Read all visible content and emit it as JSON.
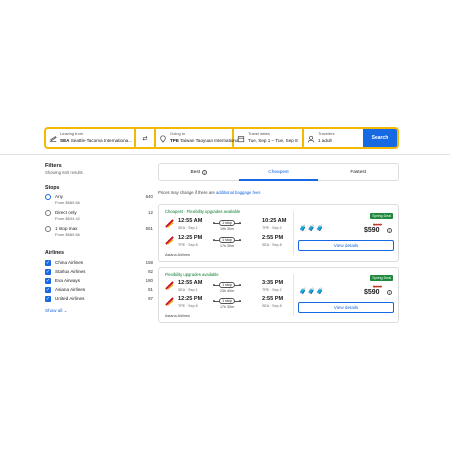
{
  "search": {
    "leaving_label": "Leaving from",
    "leaving_code": "SEA",
    "leaving_name": "Seattle-Tacoma Internationa...",
    "going_label": "Going to",
    "going_code": "TPE",
    "going_name": "Taiwan Taoyuan Internationa...",
    "dates_label": "Travel dates",
    "dates_value": "Tue, Sep 1 – Tue, Sep 8",
    "travelers_label": "Travelers",
    "travelers_value": "1 adult",
    "search_button": "Search",
    "accent_color": "#f5b800",
    "button_color": "#1668e3"
  },
  "sidebar": {
    "title": "Filters",
    "subtitle": "Showing 640 results",
    "stops_heading": "Stops",
    "stops": [
      {
        "label": "Any",
        "price": "From $589.66",
        "count": "640",
        "selected": true
      },
      {
        "label": "Direct only",
        "price": "From $634.42",
        "count": "12",
        "selected": false
      },
      {
        "label": "1 stop max",
        "price": "From $589.66",
        "count": "551",
        "selected": false
      }
    ],
    "airlines_heading": "Airlines",
    "airlines": [
      {
        "label": "China Airlines",
        "count": "158"
      },
      {
        "label": "Starlux Airlines",
        "count": "82"
      },
      {
        "label": "Eva Airways",
        "count": "180"
      },
      {
        "label": "Asiana Airlines",
        "count": "81"
      },
      {
        "label": "United Airlines",
        "count": "97"
      }
    ],
    "show_all": "Show all"
  },
  "tabs": [
    {
      "label": "Best",
      "active": false
    },
    {
      "label": "Cheapest",
      "active": true
    },
    {
      "label": "Fastest",
      "active": false
    }
  ],
  "notice": {
    "text": "Prices may change if there are",
    "link": "additional baggage fees"
  },
  "results": [
    {
      "tag": "Cheapest · Flexibility upgrades available",
      "outbound": {
        "dep_time": "12:55 AM",
        "dep_sub": "SEA · Sep 1",
        "stops": "1 stop",
        "duration": "19h 30m",
        "arr_time": "10:25 AM",
        "arr_sub": "TPE · Sep 2"
      },
      "return": {
        "dep_time": "12:25 PM",
        "dep_sub": "TPE · Sep 8",
        "stops": "1 stop",
        "duration": "17h 30m",
        "arr_time": "2:55 PM",
        "arr_sub": "SEA · Sep 8"
      },
      "airline": "Asiana Airlines",
      "deal": "Spring Deal",
      "old_price": "$602",
      "price": "$590",
      "details": "View details"
    },
    {
      "tag": "Flexibility upgrades available",
      "outbound": {
        "dep_time": "12:55 AM",
        "dep_sub": "SEA · Sep 1",
        "stops": "1 stop",
        "duration": "23h 40m",
        "arr_time": "3:35 PM",
        "arr_sub": "TPE · Sep 2"
      },
      "return": {
        "dep_time": "12:25 PM",
        "dep_sub": "TPE · Sep 8",
        "stops": "1 stop",
        "duration": "17h 30m",
        "arr_time": "2:55 PM",
        "arr_sub": "SEA · Sep 8"
      },
      "airline": "Asiana Airlines",
      "deal": "Spring Deal",
      "old_price": "$602",
      "price": "$590",
      "details": "View details"
    }
  ]
}
